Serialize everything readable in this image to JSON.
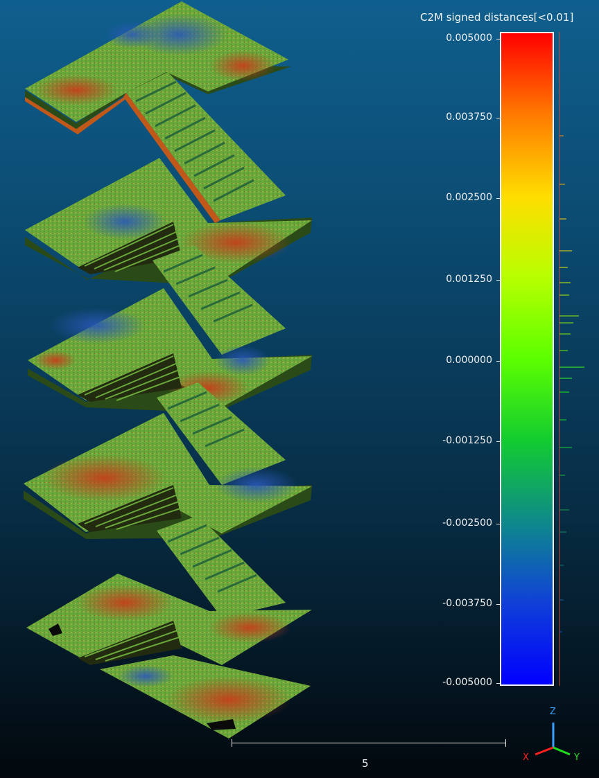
{
  "scalar_field": {
    "title": "C2M signed distances[<0.01]",
    "ticks": [
      "0.005000",
      "0.003750",
      "0.002500",
      "0.001250",
      "0.000000",
      "-0.001250",
      "-0.002500",
      "-0.003750",
      "-0.005000"
    ],
    "gradient_colors": [
      "#ff0000",
      "#ff7a00",
      "#ffdd00",
      "#b7ff00",
      "#5cff00",
      "#12cc30",
      "#0e8a8a",
      "#1040d8",
      "#0000ff"
    ]
  },
  "scale_bar": {
    "value": "5"
  },
  "axis_gizmo": {
    "x_label": "X",
    "y_label": "Y",
    "z_label": "Z",
    "x_color": "#ff2020",
    "y_color": "#20e020",
    "z_color": "#3aa0ff"
  },
  "stair_cloud": {
    "colors": {
      "base": "#6aa83a",
      "red": "#c44a1a",
      "blue": "#3060b0",
      "edge": "#c8601a",
      "shadow": "#111a0a"
    }
  }
}
